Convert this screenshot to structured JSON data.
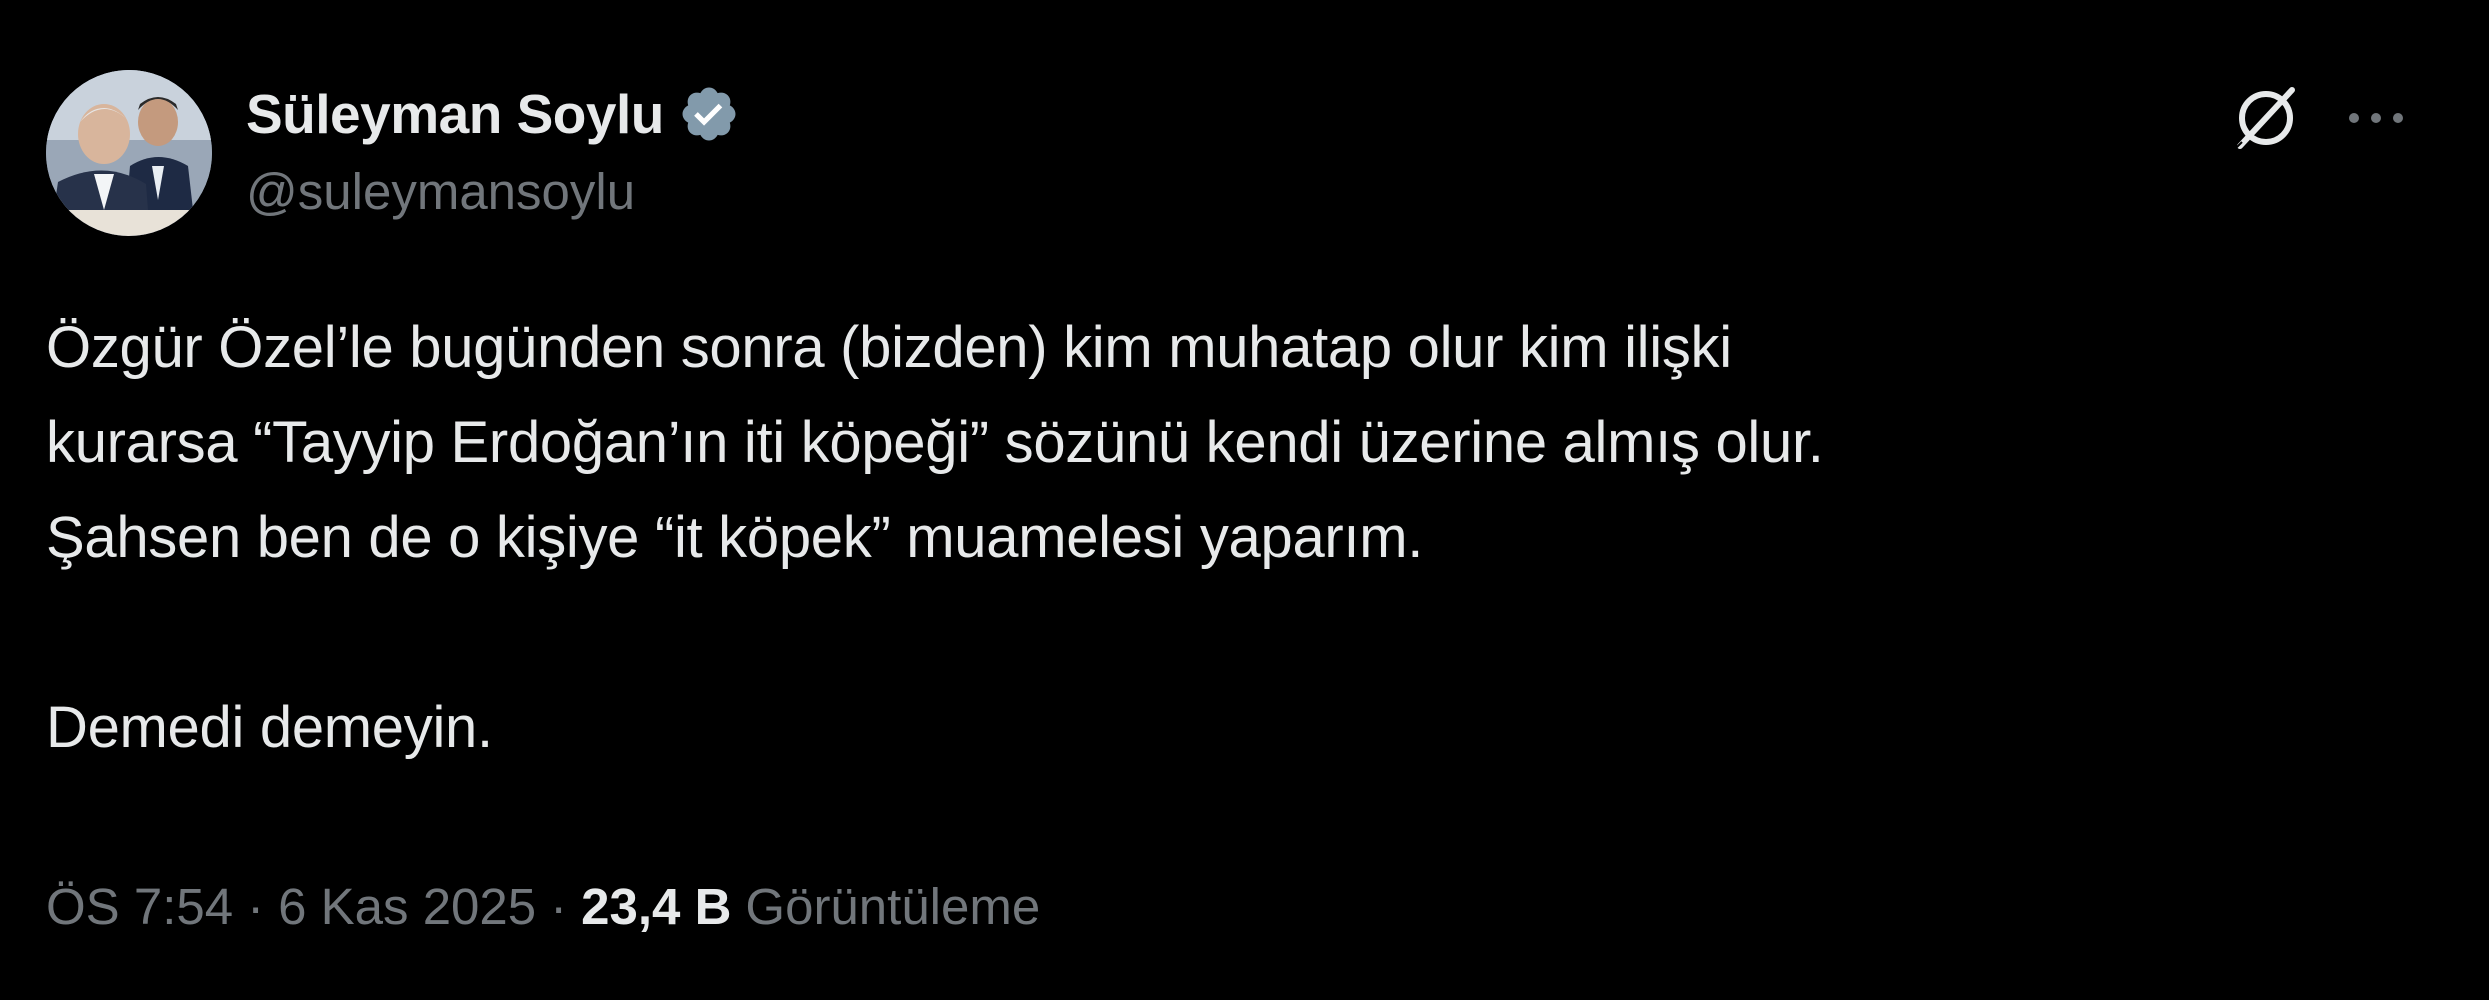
{
  "author": {
    "display_name": "Süleyman Soylu",
    "handle": "@suleymansoylu",
    "verified": true
  },
  "icons": {
    "avatar": "profile-photo",
    "verified": "verified-badge-icon",
    "grok": "grok-icon",
    "more": "more-options-icon"
  },
  "tweet": {
    "lines": [
      "Özgür Özel’le bugünden sonra (bizden) kim muhatap olur kim ilişki",
      "kurarsa  “Tayyip Erdoğan’ın iti köpeği” sözünü kendi üzerine almış olur.",
      "Şahsen ben de o kişiye “it köpek” muamelesi yaparım.",
      "Demedi demeyin."
    ]
  },
  "meta": {
    "time": "ÖS 7:54",
    "separator": "·",
    "date": "6 Kas 2025",
    "views_count": "23,4 B",
    "views_label": "Görüntüleme"
  },
  "colors": {
    "background": "#000000",
    "text_primary": "#e7e9ea",
    "text_secondary": "#71767b",
    "verified_badge": "#829aab"
  }
}
